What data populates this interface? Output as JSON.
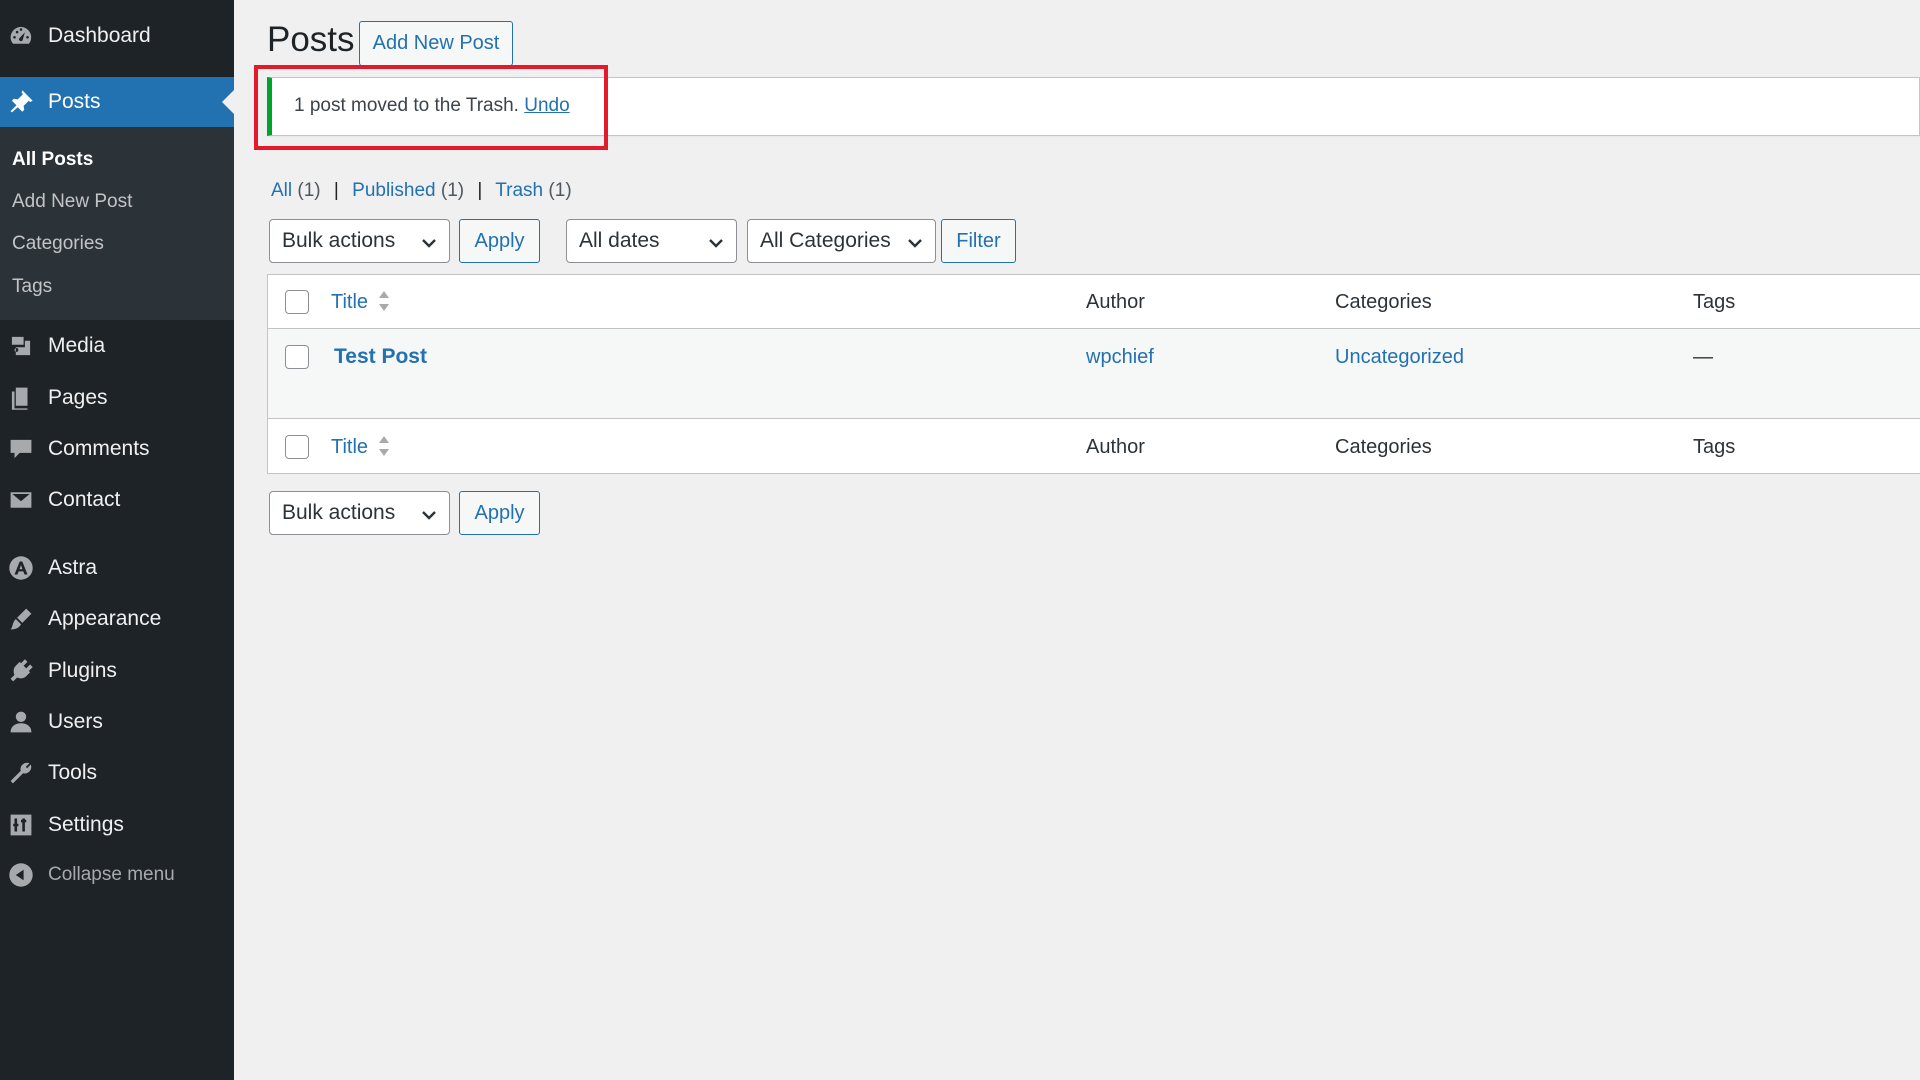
{
  "sidebar": {
    "items": [
      {
        "label": "Dashboard",
        "icon": "dashboard-icon"
      },
      {
        "label": "Posts",
        "icon": "pin-icon",
        "active": true
      },
      {
        "label": "Media",
        "icon": "media-icon"
      },
      {
        "label": "Pages",
        "icon": "pages-icon"
      },
      {
        "label": "Comments",
        "icon": "comments-icon"
      },
      {
        "label": "Contact",
        "icon": "envelope-icon"
      },
      {
        "label": "Astra",
        "icon": "astra-icon"
      },
      {
        "label": "Appearance",
        "icon": "brush-icon"
      },
      {
        "label": "Plugins",
        "icon": "plugin-icon"
      },
      {
        "label": "Users",
        "icon": "user-icon"
      },
      {
        "label": "Tools",
        "icon": "wrench-icon"
      },
      {
        "label": "Settings",
        "icon": "settings-icon"
      }
    ],
    "submenu": [
      {
        "label": "All Posts",
        "current": true
      },
      {
        "label": "Add New Post"
      },
      {
        "label": "Categories"
      },
      {
        "label": "Tags"
      }
    ],
    "collapse_label": "Collapse menu"
  },
  "header": {
    "title": "Posts",
    "add_new_label": "Add New Post"
  },
  "notice": {
    "message": "1 post moved to the Trash.",
    "undo_label": "Undo",
    "accent": "#00a32a",
    "highlight_color": "#e21a2b"
  },
  "views": [
    {
      "label": "All",
      "count": "(1)"
    },
    {
      "label": "Published",
      "count": "(1)"
    },
    {
      "label": "Trash",
      "count": "(1)"
    }
  ],
  "filters": {
    "bulk_actions": "Bulk actions",
    "apply_label": "Apply",
    "dates": "All dates",
    "categories": "All Categories",
    "filter_label": "Filter"
  },
  "table": {
    "columns": {
      "title": "Title",
      "author": "Author",
      "categories": "Categories",
      "tags": "Tags"
    },
    "rows": [
      {
        "title": "Test Post",
        "author": "wpchief",
        "categories": "Uncategorized",
        "tags": "—"
      }
    ]
  },
  "colors": {
    "sidebar_bg": "#1d2327",
    "accent": "#2271b1",
    "page_bg": "#f0f0f1"
  }
}
